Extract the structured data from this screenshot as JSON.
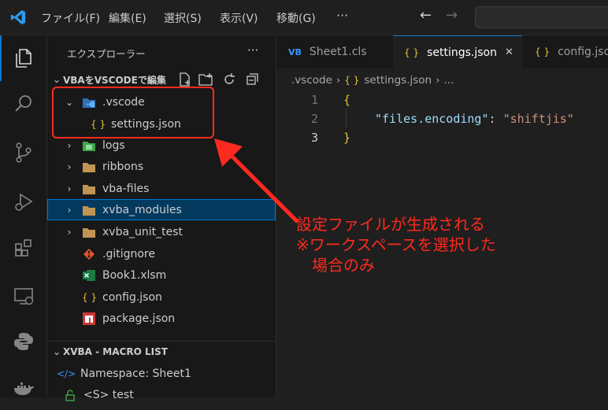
{
  "menubar": {
    "items": [
      "ファイル(F)",
      "編集(E)",
      "選択(S)",
      "表示(V)",
      "移動(G)"
    ],
    "more": "···",
    "back": "←",
    "forward": "→"
  },
  "sidebar": {
    "title": "エクスプローラー",
    "more": "···",
    "workspace": "VBAをVSCODEで編集",
    "tree": [
      {
        "label": ".vscode",
        "icon": "vscode-folder-icon",
        "expanded": true
      },
      {
        "label": "settings.json",
        "icon": "json-icon"
      },
      {
        "label": "logs",
        "icon": "folder-icon"
      },
      {
        "label": "ribbons",
        "icon": "folder-icon"
      },
      {
        "label": "vba-files",
        "icon": "folder-icon"
      },
      {
        "label": "xvba_modules",
        "icon": "folder-icon",
        "selected": true
      },
      {
        "label": "xvba_unit_test",
        "icon": "folder-icon"
      },
      {
        "label": ".gitignore",
        "icon": "git-icon"
      },
      {
        "label": "Book1.xlsm",
        "icon": "excel-icon"
      },
      {
        "label": "config.json",
        "icon": "json-icon"
      },
      {
        "label": "package.json",
        "icon": "npm-icon"
      }
    ],
    "macro_section": "XVBA - MACRO LIST",
    "macro_items": [
      "Namespace: Sheet1",
      "<S> test"
    ]
  },
  "tabs": [
    {
      "badge": "VB",
      "label": "Sheet1.cls"
    },
    {
      "badge": "{ }",
      "label": "settings.json",
      "active": true,
      "close": "✕"
    },
    {
      "badge": "{ }",
      "label": "config.json"
    }
  ],
  "breadcrumb": {
    "folder": ".vscode",
    "sep": "›",
    "icon": "{ }",
    "file": "settings.json",
    "sep2": "›",
    "more": "..."
  },
  "editor": {
    "line_numbers": [
      "1",
      "2",
      "3"
    ],
    "brace_open": "{",
    "key": "\"files.encoding\"",
    "colon": ": ",
    "value": "\"shiftjis\"",
    "brace_close": "}"
  },
  "annotation": {
    "line1": "設定ファイルが生成される",
    "line2": "※ワークスペースを選択した",
    "line3": "場合のみ",
    "color": "#ff2a1f"
  },
  "colors": {
    "accent": "#0078d4",
    "json_brace": "#e3c33a",
    "json_key": "#9cdcfe",
    "json_string": "#ce9178",
    "selection": "#04395e"
  }
}
